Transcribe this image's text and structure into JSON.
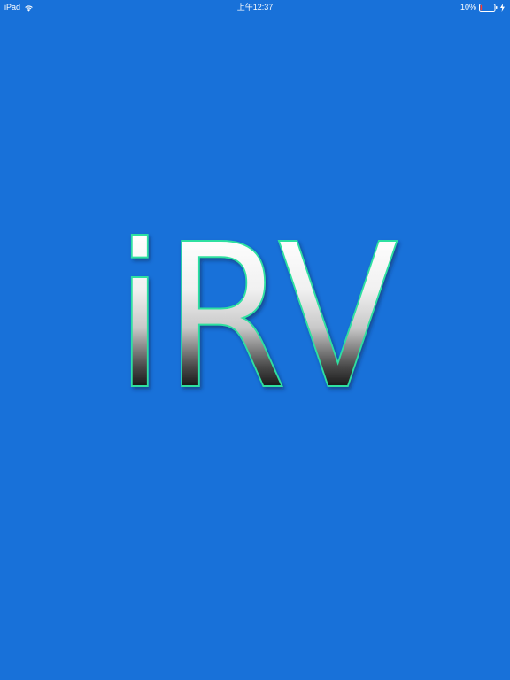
{
  "status_bar": {
    "device": "iPad",
    "time": "上午12:37",
    "battery_percent": "10%",
    "battery_level": 0.1,
    "wifi_icon": "wifi-icon",
    "battery_icon": "battery-icon",
    "charging_icon": "charging-bolt-icon"
  },
  "splash": {
    "logo_text": "iRV",
    "colors": {
      "background": "#1871d9",
      "glow": "#2fe0a0",
      "battery_low": "#ff3b30"
    }
  }
}
